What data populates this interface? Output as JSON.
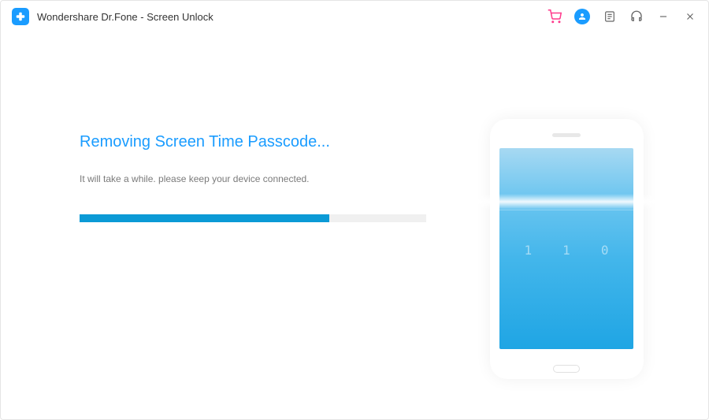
{
  "titlebar": {
    "app_name": "Wondershare Dr.Fone - Screen Unlock"
  },
  "content": {
    "heading": "Removing Screen Time Passcode...",
    "subtext": "It will take a while. please keep your device connected.",
    "progress_percent": 72
  },
  "phone": {
    "binary": [
      "1",
      "1",
      "0"
    ]
  },
  "colors": {
    "accent": "#1a9cff"
  }
}
